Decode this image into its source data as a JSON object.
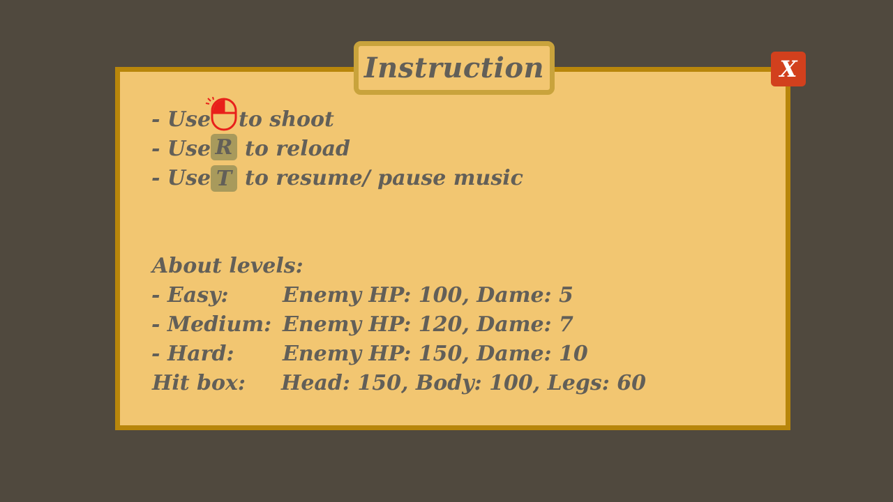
{
  "dialog": {
    "title": "Instruction",
    "close_label": "X"
  },
  "controls": [
    {
      "prefix": "- Use",
      "key": "",
      "icon": "mouse-left-click-icon",
      "action": "to shoot"
    },
    {
      "prefix": "- Use",
      "key": "R",
      "action": "to reload"
    },
    {
      "prefix": "- Use",
      "key": "T",
      "action": "to resume/ pause music"
    }
  ],
  "levels": {
    "heading": "About levels:",
    "rows": [
      {
        "label": "- Easy:",
        "value": "Enemy HP: 100, Dame: 5"
      },
      {
        "label": "- Medium:",
        "value": "Enemy HP: 120, Dame: 7"
      },
      {
        "label": "- Hard:",
        "value": "Enemy HP: 150, Dame: 10"
      },
      {
        "label": "Hit box:",
        "value": "Head: 150, Body: 100, Legs: 60"
      }
    ]
  },
  "colors": {
    "background": "#50493e",
    "panel": "#f2c671",
    "panel_border": "#b8860b",
    "text": "#625f58",
    "key_bg": "#a89a5c",
    "close_bg": "#d2401d",
    "mouse_icon": "#e8201a"
  }
}
